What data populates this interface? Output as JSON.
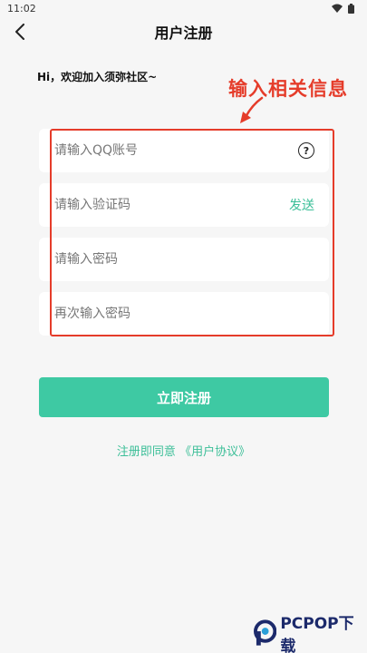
{
  "status_bar": {
    "time": "11:02"
  },
  "header": {
    "title": "用户注册"
  },
  "greeting": "Hi，欢迎加入须弥社区~",
  "annotation": "输入相关信息",
  "form": {
    "qq_placeholder": "请输入QQ账号",
    "help_symbol": "?",
    "code_placeholder": "请输入验证码",
    "send_label": "发送",
    "password_placeholder": "请输入密码",
    "confirm_placeholder": "再次输入密码"
  },
  "register_button": "立即注册",
  "agreement": {
    "prefix": "注册即同意 ",
    "link": "《用户协议》"
  },
  "watermark": "PCPOP下载",
  "colors": {
    "accent": "#3ec9a3",
    "annotation": "#e53c2a",
    "background": "#f6f6f6"
  },
  "icons": [
    "back-arrow-icon",
    "wifi-icon",
    "battery-icon",
    "help-circle-icon"
  ]
}
